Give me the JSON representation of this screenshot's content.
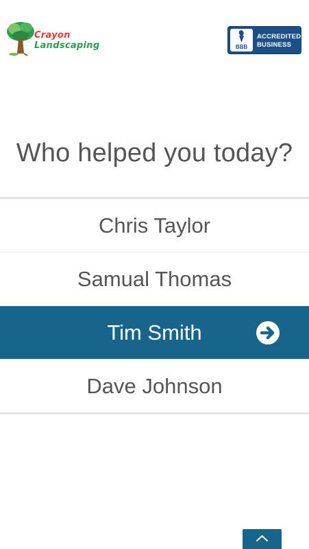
{
  "header": {
    "logo": {
      "line1": "Crayon",
      "line2": "Landscaping",
      "icon": "tree-icon"
    },
    "badge": {
      "seal_text": "BBB",
      "line1": "ACCREDITED",
      "line2": "BUSINESS"
    }
  },
  "question": "Who helped you today?",
  "staff": [
    {
      "name": "Chris Taylor"
    },
    {
      "name": "Samual Thomas"
    },
    {
      "name": "Tim Smith",
      "selected": true,
      "icon": "arrow-right-circle-icon"
    },
    {
      "name": "Dave Johnson"
    }
  ],
  "scroll_top": {
    "icon": "chevron-up-icon"
  },
  "colors": {
    "accent": "#17658b",
    "text": "#555555",
    "bbb_blue": "#1c4f86"
  }
}
